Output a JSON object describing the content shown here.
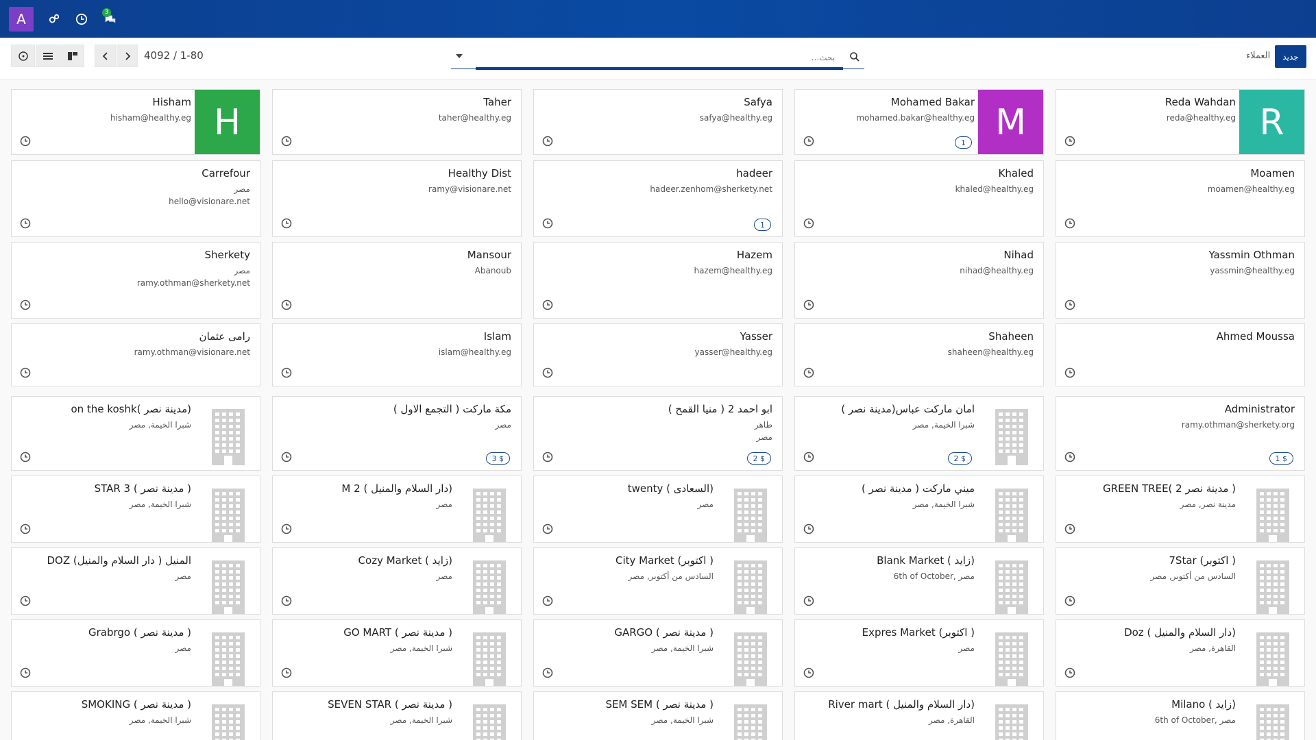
{
  "navbar": {
    "avatar_letter": "A",
    "messages_badge": "3"
  },
  "control": {
    "pager": "4092 / 1-80",
    "search_placeholder": "بحث...",
    "breadcrumb": "العملاء",
    "new_button": "جديد"
  },
  "colors": {
    "accent": "#0d3f8f",
    "avatar_h": "#2ca84a",
    "avatar_m": "#b22fc6",
    "avatar_r": "#2bb8a3"
  },
  "cards": [
    {
      "name": "Hisham",
      "lines": [
        "hisham@healthy.eg"
      ],
      "avatar": "H",
      "avatar_color": "#2ca84a"
    },
    {
      "name": "Taher",
      "lines": [
        "taher@healthy.eg"
      ]
    },
    {
      "name": "Safya",
      "lines": [
        "safya@healthy.eg"
      ]
    },
    {
      "name": "Mohamed Bakar",
      "lines": [
        "mohamed.bakar@healthy.eg"
      ],
      "avatar": "M",
      "avatar_color": "#b22fc6",
      "badge": "1"
    },
    {
      "name": "Reda Wahdan",
      "lines": [
        "reda@healthy.eg"
      ],
      "avatar": "R",
      "avatar_color": "#2bb8a3"
    },
    {
      "name": "Carrefour",
      "lines": [
        "مصر",
        "hello@visionare.net"
      ]
    },
    {
      "name": "Healthy Dist",
      "lines": [
        "ramy@visionare.net"
      ]
    },
    {
      "name": "hadeer",
      "lines": [
        "hadeer.zenhom@sherkety.net"
      ],
      "badge": "1"
    },
    {
      "name": "Khaled",
      "lines": [
        "khaled@healthy.eg"
      ]
    },
    {
      "name": "Moamen",
      "lines": [
        "moamen@healthy.eg"
      ]
    },
    {
      "name": "Sherkety",
      "lines": [
        "مصر",
        "ramy.othman@sherkety.net"
      ]
    },
    {
      "name": "Mansour",
      "lines": [
        "Abanoub"
      ]
    },
    {
      "name": "Hazem",
      "lines": [
        "hazem@healthy.eg"
      ]
    },
    {
      "name": "Nihad",
      "lines": [
        "nihad@healthy.eg"
      ]
    },
    {
      "name": "Yassmin Othman",
      "lines": [
        "yassmin@healthy.eg"
      ]
    },
    {
      "name": "رامى عثمان",
      "lines": [
        "ramy.othman@visionare.net"
      ]
    },
    {
      "name": "Islam",
      "lines": [
        "islam@healthy.eg"
      ]
    },
    {
      "name": "Yasser",
      "lines": [
        "yasser@healthy.eg"
      ]
    },
    {
      "name": "Shaheen",
      "lines": [
        "shaheen@healthy.eg"
      ]
    },
    {
      "name": "Ahmed Moussa",
      "lines": []
    },
    {
      "name": "on the koshk( مدينة نصر)",
      "lines": [
        "شبرا الخيمة, مصر"
      ],
      "company": true
    },
    {
      "name": "مكة ماركت ( التجمع الاول )",
      "lines": [
        "مصر"
      ],
      "badge": "3 $"
    },
    {
      "name": "ابو احمد 2 ( منيا القمح )",
      "lines": [
        "طاهر",
        "مصر"
      ],
      "badge": "2 $"
    },
    {
      "name": "امان ماركت عباس(مدينة نصر )",
      "lines": [
        "شبرا الخيمة, مصر"
      ],
      "company": true,
      "badge": "2 $"
    },
    {
      "name": "Administrator",
      "lines": [
        "ramy.othman@sherkety.org"
      ],
      "badge": "1 $"
    },
    {
      "name": "STAR 3 ( مدينة نصر )",
      "lines": [
        "شبرا الخيمة, مصر"
      ],
      "company": true
    },
    {
      "name": "M 2 ( دار السلام والمنيل)",
      "lines": [
        "مصر"
      ],
      "company": true
    },
    {
      "name": "twenty ( السعادى)",
      "lines": [
        "مصر"
      ],
      "company": true
    },
    {
      "name": "( ميني ماركت ( مدينة نصر",
      "lines": [
        "شبرا الخيمة, مصر"
      ],
      "company": true
    },
    {
      "name": "GREEN TREE( مدينة نصر 2 )",
      "lines": [
        "مدينة نصر, مصر"
      ],
      "company": true
    },
    {
      "name": "DOZ المنيل ( دار السلام والمنيل)",
      "lines": [
        "مصر"
      ],
      "company": true
    },
    {
      "name": "Cozy Market ( زايد)",
      "lines": [
        "مصر"
      ],
      "company": true
    },
    {
      "name": "City Market (اكتوبر )",
      "lines": [
        "السادس من أكتوبر, مصر"
      ],
      "company": true
    },
    {
      "name": "Blank Market ( زايد)",
      "lines": [
        "6th of October, مصر"
      ],
      "company": true
    },
    {
      "name": "7Star (اكتوبر )",
      "lines": [
        "السادس من أكتوبر, مصر"
      ],
      "company": true
    },
    {
      "name": "Grabrgo ( مدينة نصر )",
      "lines": [
        "مصر"
      ],
      "company": true
    },
    {
      "name": "GO MART ( مدينة نصر )",
      "lines": [
        "شبرا الخيمة, مصر"
      ],
      "company": true
    },
    {
      "name": "GARGO ( مدينة نصر )",
      "lines": [
        "شبرا الخيمة, مصر"
      ],
      "company": true
    },
    {
      "name": "Expres Market (اكتوبر )",
      "lines": [
        "مصر"
      ],
      "company": true
    },
    {
      "name": "Doz ( دار السلام والمنيل)",
      "lines": [
        "القاهرة, مصر"
      ],
      "company": true
    },
    {
      "name": "SMOKING ( مدينة نصر )",
      "lines": [
        "شبرا الخيمة, مصر"
      ],
      "company": true
    },
    {
      "name": "SEVEN STAR ( مدينة نصر )",
      "lines": [
        "شبرا الخيمة, مصر"
      ],
      "company": true
    },
    {
      "name": "SEM SEM ( مدينة نصر )",
      "lines": [
        "شبرا الخيمة, مصر"
      ],
      "company": true
    },
    {
      "name": "River mart ( دار السلام والمنيل)",
      "lines": [
        "القاهرة, مصر"
      ],
      "company": true
    },
    {
      "name": "Milano ( زايد)",
      "lines": [
        "6th of October, مصر"
      ],
      "company": true
    }
  ]
}
